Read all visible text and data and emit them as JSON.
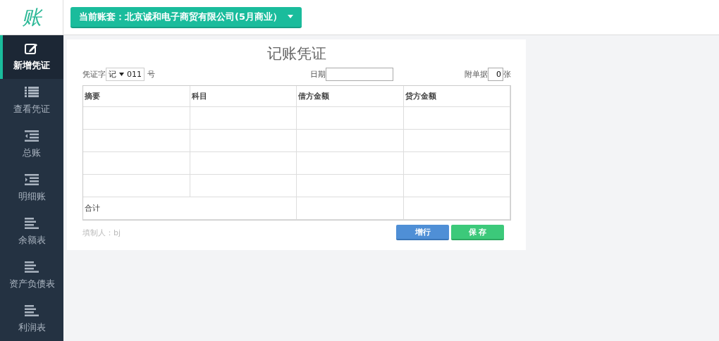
{
  "logo": "账",
  "account_button": {
    "label": "当前账套：北京诚和电子商贸有限公司(5月商业）"
  },
  "sidebar": {
    "items": [
      {
        "label": "新增凭证",
        "kind": "edit",
        "selected": true
      },
      {
        "label": "查看凭证",
        "kind": "list",
        "selected": false
      },
      {
        "label": "总账",
        "kind": "outdent",
        "selected": false
      },
      {
        "label": "明细账",
        "kind": "indent",
        "selected": false
      },
      {
        "label": "余额表",
        "kind": "bars",
        "selected": false
      },
      {
        "label": "资产负债表",
        "kind": "bars",
        "selected": false
      },
      {
        "label": "利润表",
        "kind": "bars",
        "selected": false
      }
    ]
  },
  "voucher": {
    "title": "记账凭证",
    "word_label": "凭证字",
    "word_value": "记",
    "number": "011",
    "number_suffix": "号",
    "date_label": "日期",
    "attach_label": "附单据",
    "attach_value": "0",
    "attach_suffix": "张",
    "columns": [
      "摘要",
      "科目",
      "借方金额",
      "贷方金额"
    ],
    "total_label": "合计",
    "preparer": "填制人：bj",
    "buttons": [
      {
        "label": "增行",
        "kind": "add"
      },
      {
        "label": "保 存",
        "kind": "save"
      }
    ]
  }
}
